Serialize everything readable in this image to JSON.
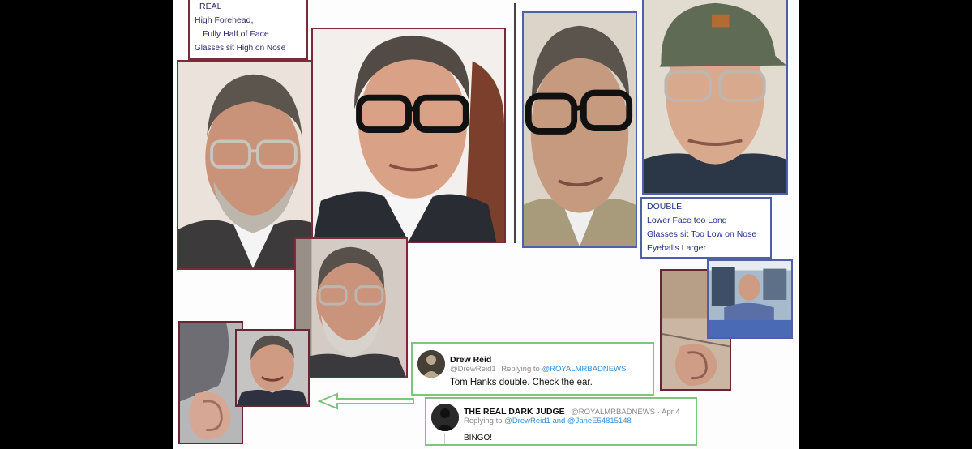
{
  "real_label": {
    "lines": [
      "REAL",
      "High Forehead,",
      "Fully Half of Face",
      "Glasses sit High on Nose"
    ]
  },
  "double_label": {
    "lines": [
      "DOUBLE",
      "Lower Face too Long",
      "Glasses sit Too Low on Nose",
      "Eyeballs Larger"
    ]
  },
  "tweet1": {
    "name": "Drew Reid",
    "handle": "@DrewReid1",
    "replying_prefix": "Replying to",
    "replying_to": "@ROYALMRBADNEWS",
    "body": "Tom Hanks double.  Check the ear."
  },
  "tweet2": {
    "name": "THE REAL DARK JUDGE",
    "handle_date": "@ROYALMRBADNEWS · Apr 4",
    "replying_prefix": "Replying to",
    "replying_to": "@DrewReid1 and @JaneE54815148",
    "body": "BINGO!"
  },
  "colors": {
    "real_border": "#7a2a38",
    "double_border": "#4f5fa8",
    "tweet_border": "#7fc47f",
    "arrow": "#7fc47f",
    "link": "#3a8fd6"
  }
}
